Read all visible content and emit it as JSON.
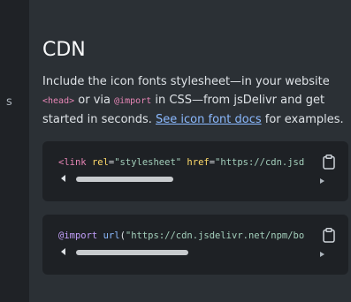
{
  "sidebar_fragment": "s",
  "section": {
    "title": "CDN",
    "description": {
      "line1": "Include the icon fonts stylesheet—in your website",
      "head_tag": "<head>",
      "line2_or_via": " or via ",
      "import_keyword": "@import",
      "line2_rest": " in CSS—from jsDelivr and get",
      "line3_pre": "started in seconds. ",
      "link_text": "See icon font docs",
      "line3_post": " for examples."
    }
  },
  "code_blocks": [
    {
      "tokens": {
        "open": "<link",
        "rel_attr": "rel",
        "rel_eq": "=",
        "rel_value": "\"stylesheet\"",
        "href_attr": "href",
        "href_eq": "=",
        "href_value": "\"https://cdn.jsdelivr.net/npm/bootstrap-icons"
      },
      "copy_icon": "clipboard-icon"
    },
    {
      "tokens": {
        "at_rule": "@import",
        "fn": "url",
        "paren_open": "(",
        "url_value": "\"https://cdn.jsdelivr.net/npm/bootstrap-icons"
      },
      "copy_icon": "clipboard-icon"
    }
  ],
  "colors": {
    "background": "#212529",
    "content_background": "#2b3035",
    "code_background": "#1e2125",
    "link": "#8bb9fe",
    "inline_code": "#e685b5"
  }
}
